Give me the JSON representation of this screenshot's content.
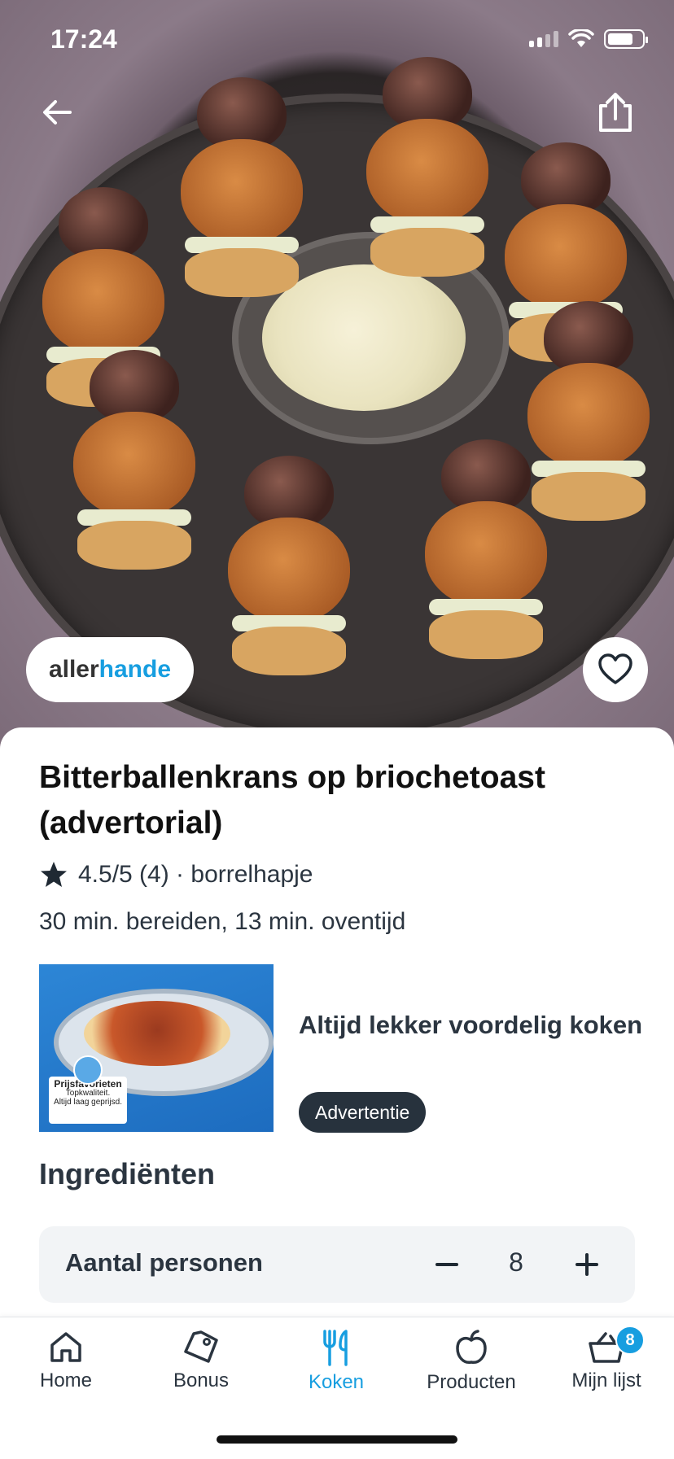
{
  "status_bar": {
    "time": "17:24"
  },
  "hero": {
    "brand_prefix": "aller",
    "brand_suffix": "hande"
  },
  "recipe": {
    "title": "Bitterballenkrans op briochetoast (advertorial)",
    "rating": "4.5/5 (4) · borrelhapje",
    "timing": "30 min. bereiden, 13 min. oventijd"
  },
  "ad": {
    "title": "Altijd lekker voordelig koken",
    "badge": "Advertentie",
    "image_label_title": "Prijsfavorieten",
    "image_label_line1": "Topkwaliteit.",
    "image_label_line2": "Altijd laag geprijsd."
  },
  "ingredients": {
    "title": "Ingrediënten",
    "persons_label": "Aantal personen",
    "persons_count": "8"
  },
  "tabbar": {
    "items": [
      {
        "label": "Home",
        "icon": "home-icon"
      },
      {
        "label": "Bonus",
        "icon": "tag-icon"
      },
      {
        "label": "Koken",
        "icon": "cutlery-icon",
        "active": true
      },
      {
        "label": "Producten",
        "icon": "apple-icon"
      },
      {
        "label": "Mijn lijst",
        "icon": "basket-icon",
        "badge": "8"
      }
    ]
  },
  "colors": {
    "accent": "#179ee0",
    "dark": "#27323d",
    "text": "#2b3540"
  }
}
